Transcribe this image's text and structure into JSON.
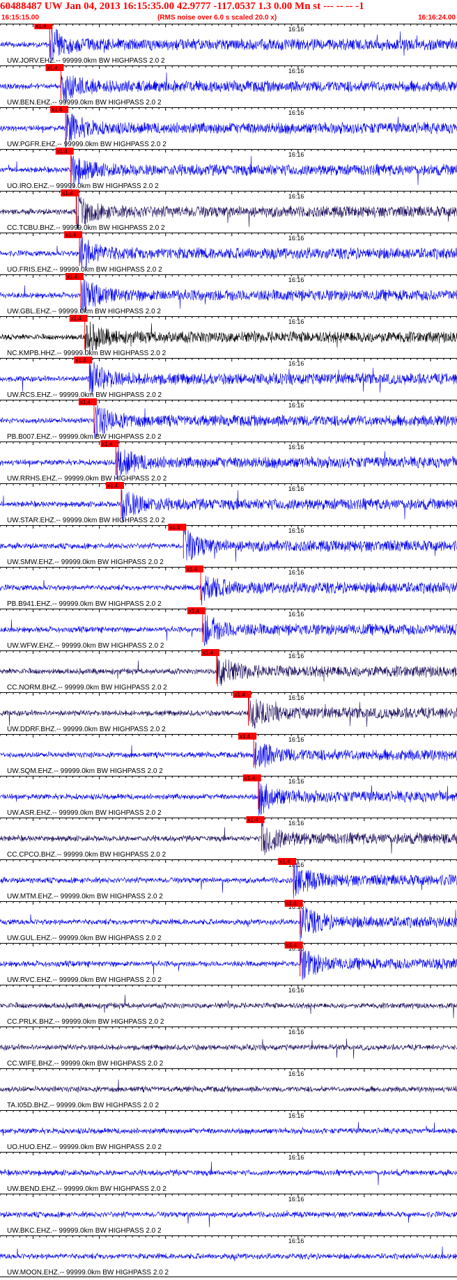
{
  "header": {
    "title": "60488487 UW Jan 04, 2013 16:15:35.00   42.9777 -117.0537  1.3 0.00 Mn st --- -- --  -1",
    "start_time": "16:15:15.00",
    "scale_note": "(RMS noise over 6.0 s scaled 20.0 x)",
    "end_time": "16:16:24.00"
  },
  "colors": {
    "pick_marker": "#ff0000",
    "trace_blue": "#0000ee",
    "trace_navy": "#1a0a5a",
    "trace_black": "#000000",
    "timing_line": "#000000"
  },
  "chart_data": {
    "type": "line",
    "title": "60488487 UW Jan 04, 2013 16:15:35.00   42.9777 -117.0537  1.3 0.00 Mn st --- -- --  -1",
    "time_range": [
      "16:15:15.00",
      "16:16:24.00"
    ],
    "minute_mark_label": "16:16",
    "tick_interval_s": 1,
    "pick_label": "x1.4",
    "series": [
      {
        "name": "UW.JORV.EHZ.-- 99999.0km BW  HIGHPASS  2.0  2",
        "color": "#0000ee",
        "pick_s": 7.5
      },
      {
        "name": "UW.BEN.EHZ.-- 99999.0km BW  HIGHPASS  2.0  2",
        "color": "#0000ee",
        "pick_s": 9.2
      },
      {
        "name": "UW.PGFR.EHZ.-- 99999.0km BW  HIGHPASS  2.0  2",
        "color": "#0000ee",
        "pick_s": 9.9
      },
      {
        "name": "UO.IRO.EHZ.-- 99999.0km BW  HIGHPASS  2.0  2",
        "color": "#0000ee",
        "pick_s": 10.7
      },
      {
        "name": "CC.TCBU.BHZ.-- 99999.0km BW  HIGHPASS  2.0  2",
        "color": "#1a0a5a",
        "pick_s": 11.5
      },
      {
        "name": "UO.FRIS.EHZ.-- 99999.0km BW  HIGHPASS  2.0  2",
        "color": "#0000ee",
        "pick_s": 12.0
      },
      {
        "name": "UW.GBL.EHZ.-- 99999.0km BW  HIGHPASS  2.0  2",
        "color": "#0000ee",
        "pick_s": 12.2
      },
      {
        "name": "NC.KMPB.HHZ.-- 99999.0km BW  HIGHPASS  2.0  2",
        "color": "#000000",
        "pick_s": 12.8
      },
      {
        "name": "UW.RCS.EHZ.-- 99999.0km BW  HIGHPASS  2.0  2",
        "color": "#0000ee",
        "pick_s": 13.5
      },
      {
        "name": "PB.B007.EHZ.-- 99999.0km BW  HIGHPASS  2.0  2",
        "color": "#0000ee",
        "pick_s": 14.2
      },
      {
        "name": "UW.RRHS.EHZ.-- 99999.0km BW  HIGHPASS  2.0  2",
        "color": "#0000ee",
        "pick_s": 17.5
      },
      {
        "name": "UW.STAR.EHZ.-- 99999.0km BW  HIGHPASS  2.0  2",
        "color": "#0000ee",
        "pick_s": 18.3
      },
      {
        "name": "UW.SMW.EHZ.-- 99999.0km BW  HIGHPASS  2.0  2",
        "color": "#0000ee",
        "pick_s": 27.7
      },
      {
        "name": "PB.B941.EHZ.-- 99999.0km BW  HIGHPASS  2.0  2",
        "color": "#0000ee",
        "pick_s": 30.3
      },
      {
        "name": "UW.WFW.EHZ.-- 99999.0km BW  HIGHPASS  2.0  2",
        "color": "#0000ee",
        "pick_s": 30.6
      },
      {
        "name": "CC.NORM.BHZ.-- 99999.0km BW  HIGHPASS  2.0  2",
        "color": "#1a0a5a",
        "pick_s": 32.7
      },
      {
        "name": "UW.DDRF.BHZ.-- 99999.0km BW  HIGHPASS  2.0  2",
        "color": "#1a0a5a",
        "pick_s": 37.5
      },
      {
        "name": "UW.SQM.EHZ.-- 99999.0km BW  HIGHPASS  2.0  2",
        "color": "#0000ee",
        "pick_s": 38.3
      },
      {
        "name": "UW.ASR.EHZ.-- 99999.0km BW  HIGHPASS  2.0  2",
        "color": "#0000ee",
        "pick_s": 39.0
      },
      {
        "name": "CC.CPCO.BHZ.-- 99999.0km BW  HIGHPASS  2.0  2",
        "color": "#1a0a5a",
        "pick_s": 39.5
      },
      {
        "name": "UW.MTM.EHZ.-- 99999.0km BW  HIGHPASS  2.0  2",
        "color": "#0000ee",
        "pick_s": 44.3
      },
      {
        "name": "UW.GUL.EHZ.-- 99999.0km BW  HIGHPASS  2.0  2",
        "color": "#0000ee",
        "pick_s": 45.3
      },
      {
        "name": "UW.RVC.EHZ.-- 99999.0km BW  HIGHPASS  2.0  2",
        "color": "#0000ee",
        "pick_s": 45.3
      },
      {
        "name": "CC.PRLK.BHZ.-- 99999.0km BW  HIGHPASS  2.0  2",
        "color": "#1a0a5a",
        "pick_s": null
      },
      {
        "name": "CC.WIFE.BHZ.-- 99999.0km BW  HIGHPASS  2.0  2",
        "color": "#1a0a5a",
        "pick_s": null
      },
      {
        "name": "TA.I05D.BHZ.-- 99999.0km BW  HIGHPASS  2.0  2",
        "color": "#1a0a5a",
        "pick_s": null
      },
      {
        "name": "UO.HUO.EHZ.-- 99999.0km BW  HIGHPASS  2.0  2",
        "color": "#0000ee",
        "pick_s": null
      },
      {
        "name": "UW.BEND.EHZ.-- 99999.0km BW  HIGHPASS  2.0  2",
        "color": "#0000ee",
        "pick_s": null
      },
      {
        "name": "UW.BKC.EHZ.-- 99999.0km BW  HIGHPASS  2.0  2",
        "color": "#0000ee",
        "pick_s": null
      },
      {
        "name": "UW.MOON.EHZ.-- 99999.0km BW  HIGHPASS  2.0  2",
        "color": "#0000ee",
        "pick_s": null
      }
    ]
  }
}
